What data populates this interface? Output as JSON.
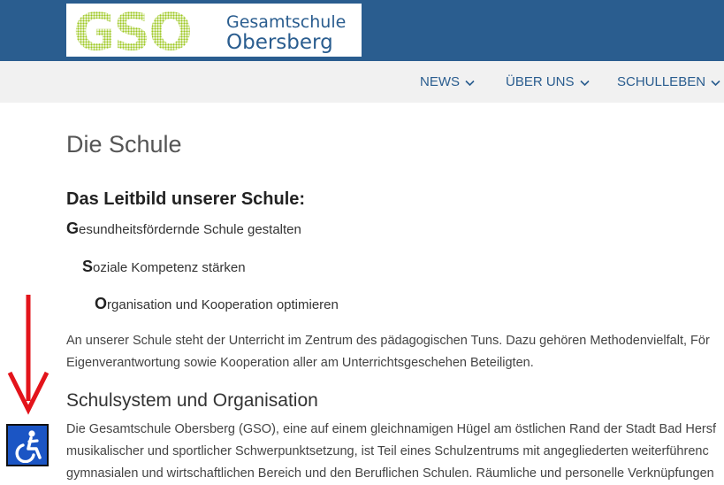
{
  "header": {
    "logo_mark": "GSO",
    "logo_line1": "Gesamtschule",
    "logo_line2": "Obersberg"
  },
  "nav": {
    "items": [
      {
        "label": "NEWS"
      },
      {
        "label": "ÜBER UNS"
      },
      {
        "label": "SCHULLEBEN"
      }
    ]
  },
  "main": {
    "title": "Die Schule",
    "leitbild_heading": "Das Leitbild unserer Schule:",
    "mottos": [
      {
        "initial": "G",
        "rest": "esundheitsfördernde Schule gestalten"
      },
      {
        "initial": "S",
        "rest": "oziale Kompetenz stärken"
      },
      {
        "initial": "O",
        "rest": "rganisation und Kooperation optimieren"
      }
    ],
    "intro_lines": [
      "An unserer Schule steht der Unterricht im Zentrum des pädagogischen Tuns. Dazu gehören Methodenvielfalt, För",
      "Eigenverantwortung sowie Kooperation aller am Unterrichtsgeschehen Beteiligten."
    ],
    "section_heading": "Schulsystem und Organisation",
    "section_lines": [
      "Die Gesamtschule Obersberg (GSO), eine auf einem gleichnamigen Hügel am östlichen Rand der Stadt Bad Hersf",
      "musikalischer und sportlicher Schwerpunktsetzung, ist Teil eines Schulzentrums mit angegliederten weiterführenc",
      "gymnasialen und wirtschaftlichen Bereich und den Beruflichen Schulen. Räumliche und personelle Verknüpfungen"
    ]
  },
  "colors": {
    "header_bg": "#2a5d8f",
    "nav_bg": "#f1f1f1",
    "logo_green": "#9cc71f",
    "arrow_red": "#e3141b",
    "accessibility_blue": "#1b55c4"
  },
  "icons": {
    "nav_chevron": "chevron-down-icon",
    "accessibility": "wheelchair-icon",
    "annotation": "arrow-down-icon"
  }
}
